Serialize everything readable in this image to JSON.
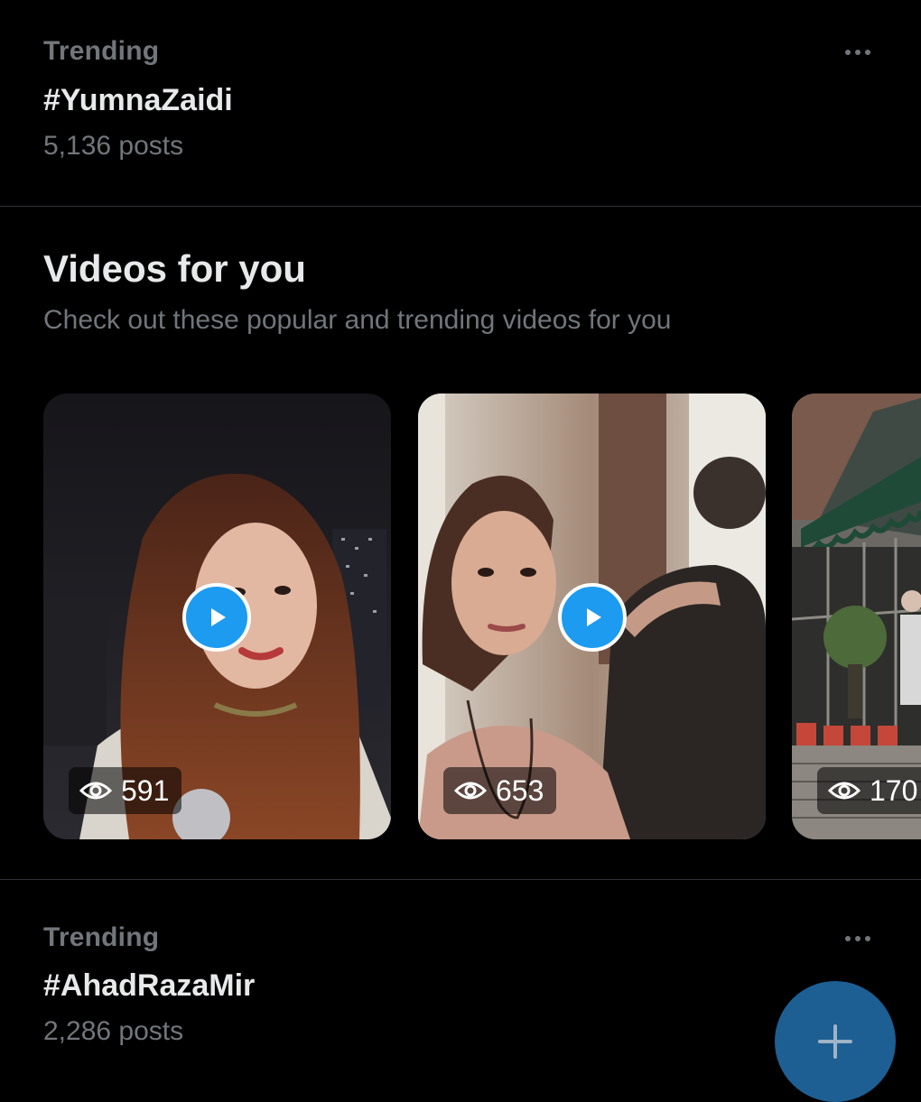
{
  "trends": [
    {
      "category": "Trending",
      "tag": "#YumnaZaidi",
      "count": "5,136 posts"
    },
    {
      "category": "Trending",
      "tag": "#AhadRazaMir",
      "count": "2,286 posts"
    }
  ],
  "videos_section": {
    "title": "Videos for you",
    "subtitle": "Check out these popular and trending videos for you",
    "videos": [
      {
        "views": "591"
      },
      {
        "views": "653"
      },
      {
        "views": "170"
      }
    ]
  },
  "icons": {
    "more": "more-horizontal-icon",
    "play": "play-icon",
    "views": "eye-icon",
    "compose": "plus-icon"
  },
  "colors": {
    "background": "#000000",
    "text_primary": "#e7e9ea",
    "text_secondary": "#71767b",
    "accent": "#1d9bf0",
    "fab": "#1d5f93"
  }
}
